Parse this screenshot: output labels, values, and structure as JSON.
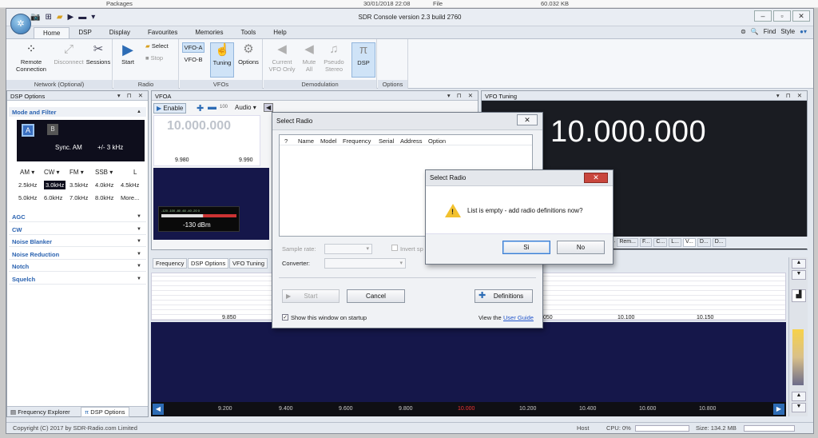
{
  "background": {
    "explorer_row": {
      "name": "Packages",
      "date": "30/01/2018 22:08",
      "type": "File",
      "size": "60.032 KB"
    }
  },
  "app": {
    "title": "SDR Console version 2.3 build 2760",
    "tabs": [
      "Home",
      "DSP",
      "Display",
      "Favourites",
      "Memories",
      "Tools",
      "Help"
    ],
    "find_label": "Find",
    "style_label": "Style"
  },
  "ribbon": {
    "network": {
      "label": "Network (Optional)",
      "remote": "Remote Connection",
      "disconnect": "Disconnect",
      "sessions": "Sessions"
    },
    "radio": {
      "label": "Radio",
      "start": "Start",
      "select": "Select",
      "stop": "Stop"
    },
    "vfos": {
      "label": "VFOs",
      "vfo_a": "VFO-A",
      "vfo_b": "VFO-B",
      "tuning": "Tuning",
      "options": "Options"
    },
    "demod": {
      "label": "Demodulation",
      "current": "Current VFO Only",
      "mute": "Mute All",
      "pseudo": "Pseudo Stereo",
      "dsp": "DSP"
    },
    "options": {
      "label": "Options"
    }
  },
  "dsp_panel": {
    "title": "DSP Options",
    "mode_header": "Mode and Filter",
    "a_label": "A",
    "b_label": "B",
    "mode_text": "Sync. AM",
    "bw_text": "+/- 3 kHz",
    "modes": [
      "AM",
      "CW",
      "FM",
      "SSB",
      "L"
    ],
    "filters_row1": [
      "2.5kHz",
      "3.0kHz",
      "3.5kHz",
      "4.0kHz",
      "4.5kHz"
    ],
    "filters_row2": [
      "5.0kHz",
      "6.0kHz",
      "7.0kHz",
      "8.0kHz",
      "More..."
    ],
    "sections": [
      "AGC",
      "CW",
      "Noise Blanker",
      "Noise Reduction",
      "Notch",
      "Squelch"
    ],
    "bottom_tabs": [
      "Frequency Explorer",
      "DSP Options"
    ]
  },
  "vfoa": {
    "title": "VFOA",
    "enable": "Enable",
    "step": "100",
    "audio": "Audio",
    "frequency": "10.000.000",
    "ticks": [
      "9.980",
      "9.990"
    ],
    "smeter_scale": "-120 -100 -80 -60 -40 -20 0",
    "smeter_db": "-130 dBm",
    "tabs": [
      "Frequency",
      "DSP Options",
      "VFO Tuning"
    ]
  },
  "vfo_tuning": {
    "title": "VFO Tuning",
    "frequency": "10.000.000",
    "tabs": [
      "c...",
      "Rem...",
      "F...",
      "C...",
      "L...",
      "V...",
      "D...",
      "D..."
    ]
  },
  "spectrum": {
    "upper_ticks": [
      "9.850",
      "050",
      "10.100",
      "10.150"
    ],
    "lower_ticks": [
      "9.200",
      "9.400",
      "9.600",
      "9.800",
      "10.000",
      "10.200",
      "10.400",
      "10.600",
      "10.800"
    ]
  },
  "status": {
    "copyright": "Copyright (C) 2017 by SDR-Radio.com Limited",
    "host": "Host",
    "cpu": "CPU: 0%",
    "size": "Size: 134.2 MB"
  },
  "select_radio": {
    "title": "Select Radio",
    "columns": [
      "?",
      "Name",
      "Model",
      "Frequency",
      "Serial",
      "Address",
      "Option"
    ],
    "sample_rate_label": "Sample rate:",
    "invert_label": "Invert sp",
    "converter_label": "Converter:",
    "start": "Start",
    "cancel": "Cancel",
    "definitions": "Definitions",
    "show_startup": "Show this window on startup",
    "view_the": "View the",
    "user_guide": "User Guide"
  },
  "confirm": {
    "title": "Select Radio",
    "message": "List is empty - add radio definitions now?",
    "yes": "Sì",
    "no": "No"
  }
}
